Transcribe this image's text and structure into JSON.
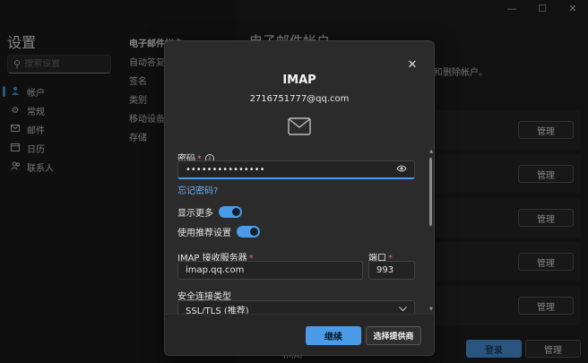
{
  "window": {
    "minimize": "—",
    "maximize": "☐",
    "close": "✕"
  },
  "sidebar": {
    "title": "设置",
    "search_placeholder": "搜索设置",
    "items": [
      {
        "label": "帐户",
        "icon": "person-icon"
      },
      {
        "label": "常规",
        "icon": "gear-icon"
      },
      {
        "label": "邮件",
        "icon": "mail-icon"
      },
      {
        "label": "日历",
        "icon": "calendar-icon"
      },
      {
        "label": "联系人",
        "icon": "people-icon"
      }
    ]
  },
  "subnav": {
    "items": [
      "电子邮件帐户",
      "自动答复",
      "签名",
      "类别",
      "移动设备",
      "存储"
    ]
  },
  "main": {
    "title": "电子邮件帐户",
    "desc": "加帐户和删除帐户。",
    "manage_label": "管理",
    "signin_label": "登录",
    "bottom_item": "IMAP"
  },
  "dialog": {
    "title": "IMAP",
    "email": "2716751777@qq.com",
    "password_label": "密码",
    "password_value": "•••••••••••••••",
    "forgot_password": "忘记密码?",
    "show_more": "显示更多",
    "use_recommended": "使用推荐设置",
    "imap_server_label": "IMAP 接收服务器",
    "imap_server_value": "imap.qq.com",
    "port_label": "端口",
    "port_value": "993",
    "security_label": "安全连接类型",
    "security_value": "SSL/TLS (推荐)",
    "continue_label": "继续",
    "choose_provider_label": "选择提供商",
    "required_mark": "*",
    "info_mark": "i"
  },
  "colors": {
    "accent": "#4c9be8",
    "background": "#1f1f1f",
    "dialog": "#2b2b2b"
  }
}
